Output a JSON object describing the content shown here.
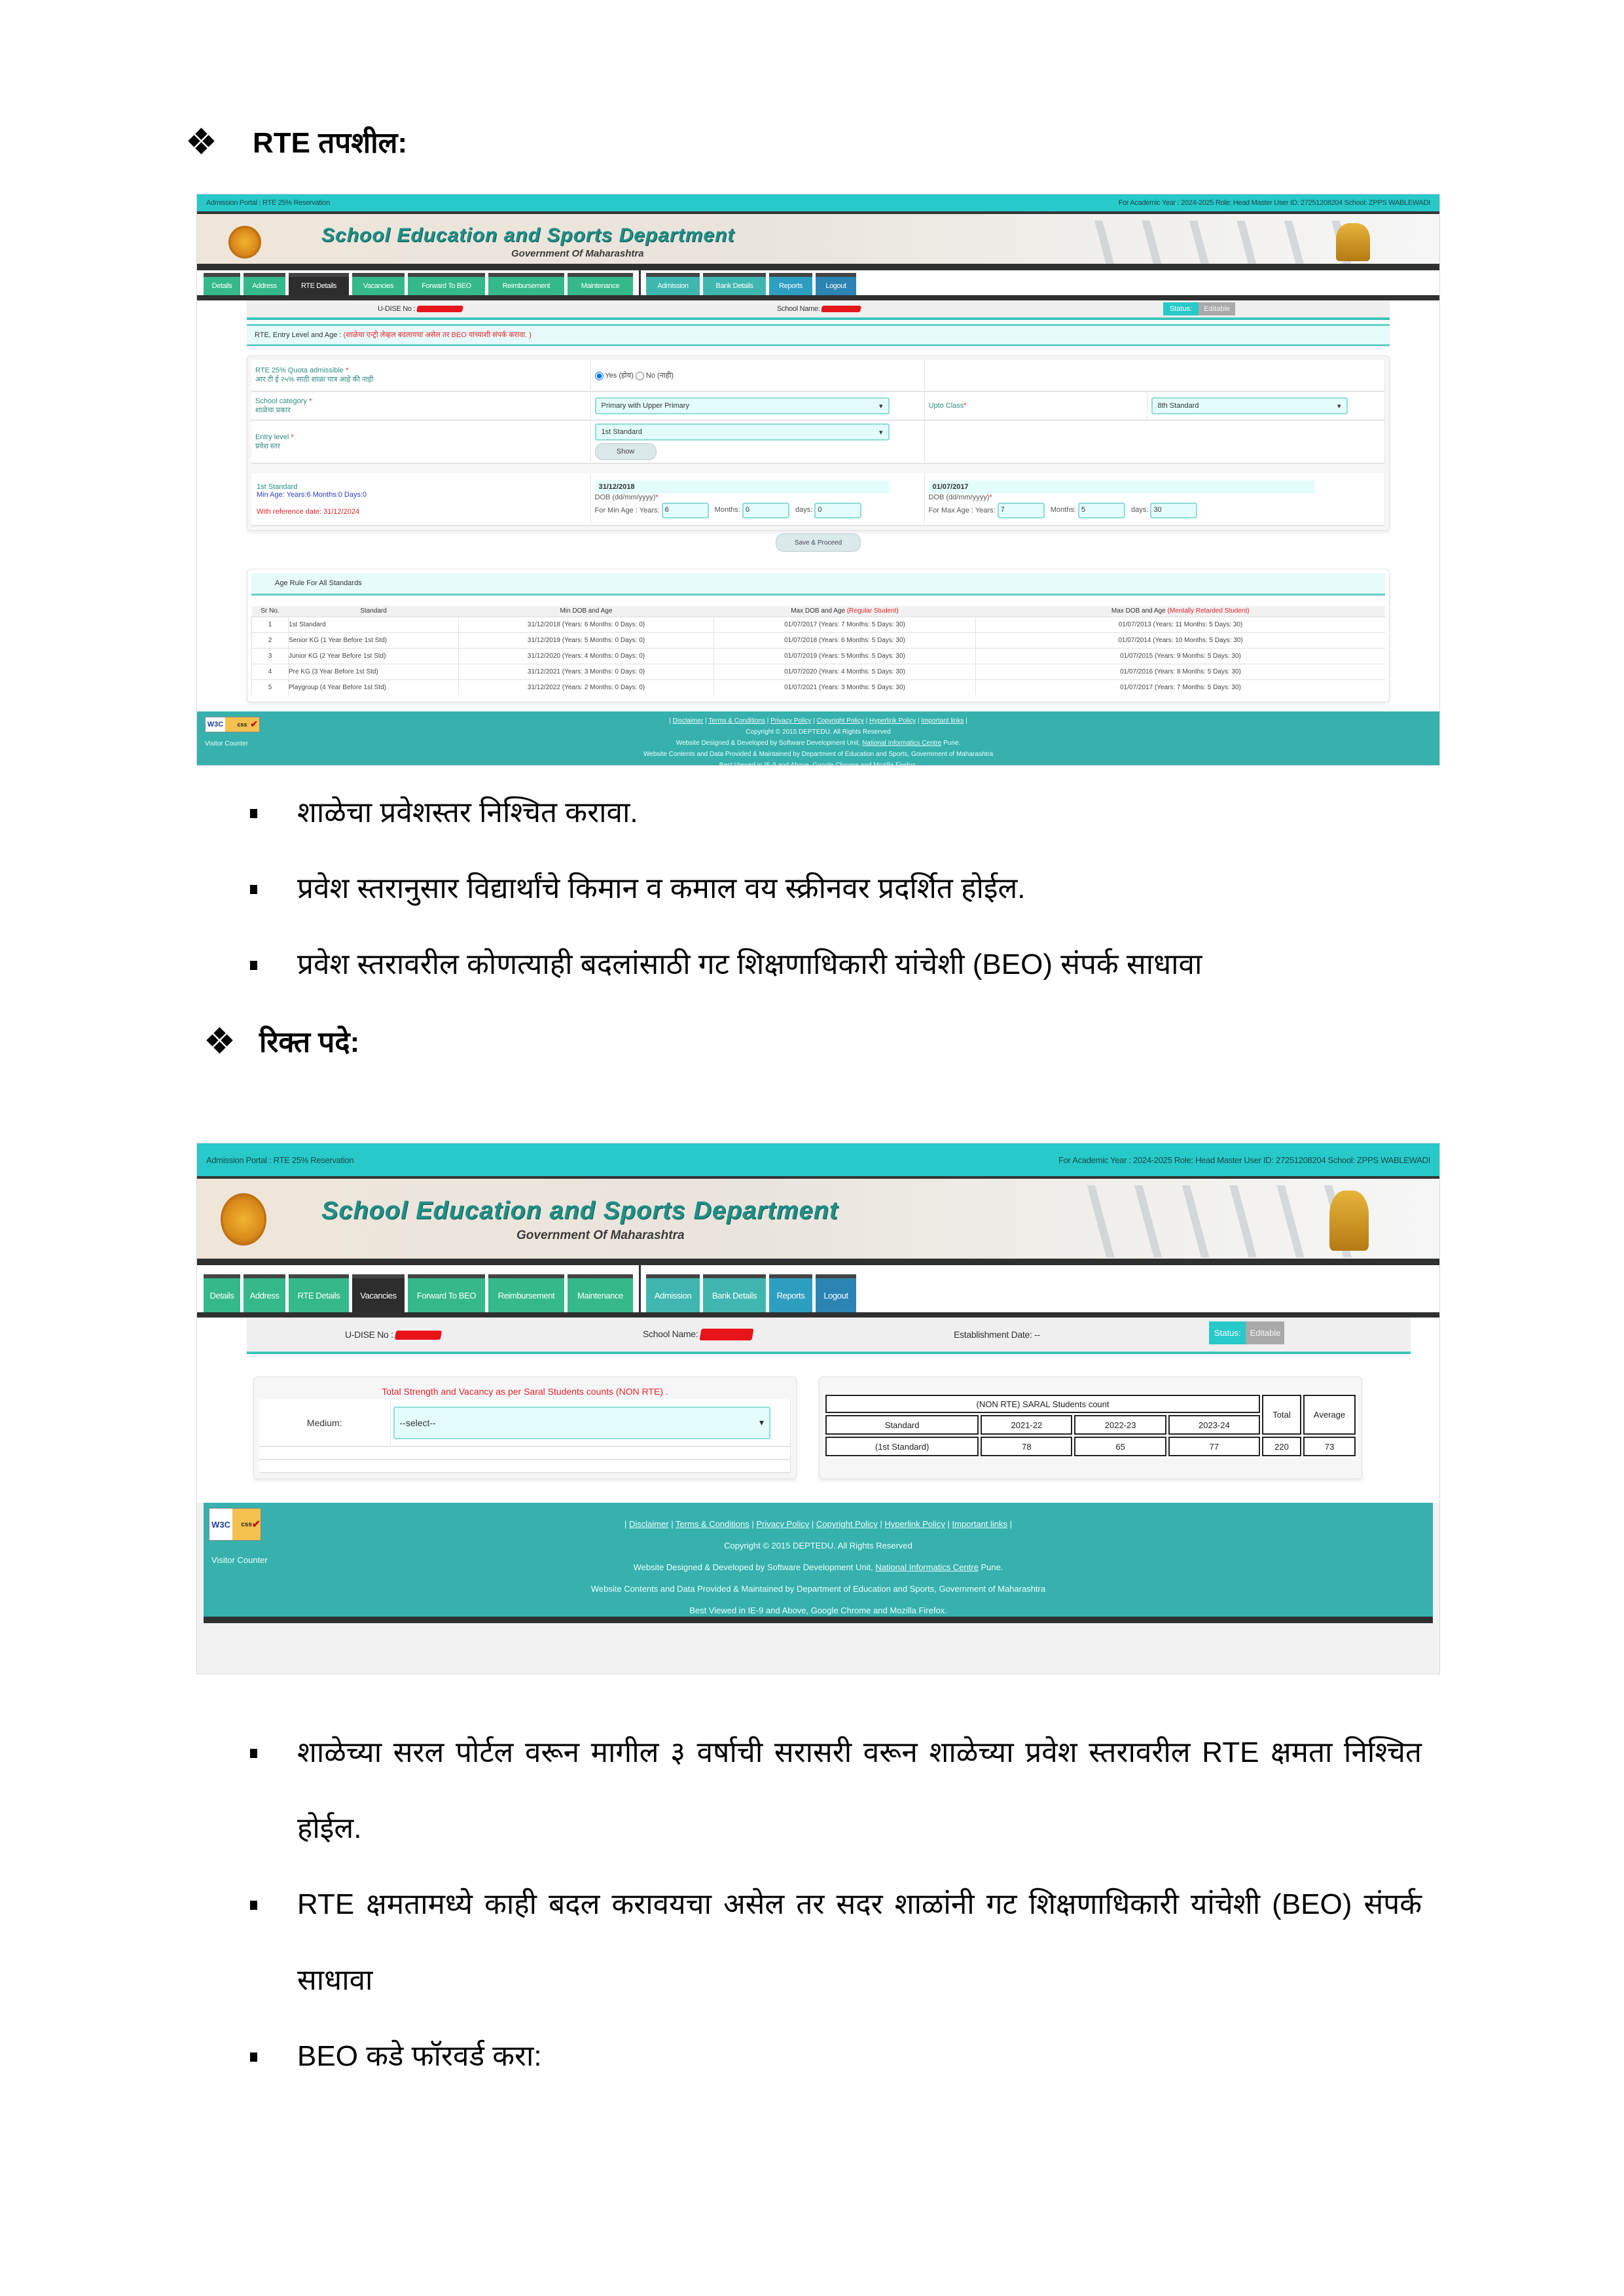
{
  "doc": {
    "section1_heading": "RTE तपशील:",
    "section1_bullets": [
      "शाळेचा प्रवेशस्तर निश्चित करावा.",
      "प्रवेश स्तरानुसार विद्यार्थांचे किमान व कमाल वय स्क्रीनवर प्रदर्शित होईल.",
      "प्रवेश स्तरावरील कोणत्याही बदलांसाठी गट शिक्षणाधिकारी यांचेशी (BEO) संपर्क साधावा"
    ],
    "section2_heading": "रिक्त पदे:",
    "section2_bullets": [
      "शाळेच्या सरल पोर्टल वरून मागील ३ वर्षाची सरासरी वरून शाळेच्या प्रवेश स्तरावरील RTE क्षमता निश्चित होईल.",
      "RTE क्षमतामध्ये काही बदल करावयचा असेल तर सदर शाळांनी गट शिक्षणाधिकारी यांचेशी (BEO) संपर्क साधावा",
      "BEO कडे फॉरवर्ड करा:"
    ]
  },
  "portal": {
    "top_left": "Admission Portal : RTE 25% Reservation",
    "top_right": "For Academic Year : 2024-2025   Role: Head Master   User ID: 27251208204   School: ZPPS WABLEWADI",
    "title": "School Education and Sports Department",
    "subtitle": "Government Of Maharashtra",
    "tabs": [
      "Details",
      "Address",
      "RTE Details",
      "Vacancies",
      "Forward To BEO",
      "Reimbursement",
      "Maintenance",
      "Admission",
      "Bank Details",
      "Reports",
      "Logout"
    ],
    "udise_label": "U-DISE No :",
    "school_name_label": "School Name:",
    "establishment_label": "Establishment Date: --",
    "status_label": "Status:",
    "status_value": "Editable",
    "footer": {
      "links": [
        "Disclaimer",
        "Terms & Conditions",
        "Privacy Policy",
        "Copyright Policy",
        "Hyperlink Policy",
        "Important links"
      ],
      "copyright": "Copyright © 2015 DEPTEDU. All Rights Reserved",
      "designed_prefix": "Website Designed & Developed by Software Development Unit, ",
      "designed_link": "National Informatics Centre",
      "designed_suffix": " Pune.",
      "contents": "Website Contents and Data Provided & Maintained by Department of Education and Sports, Government of Maharashtra",
      "best_viewed": "Best Viewed in IE-9 and Above, Google Chrome and Mozilla Firefox.",
      "visitor_counter": "Visitor Counter",
      "w3c_left": "W3C",
      "w3c_right": "css",
      "w3c_check": "✔"
    }
  },
  "rte_details": {
    "note_label": "RTE, Entry Level and Age :",
    "note_red": "(शाळेचा एन्ट्री लेव्हल बदलायचा असेल तर BEO यांच्याशी संपर्क करावा. )",
    "quota_label": "RTE 25% Quota admissible",
    "quota_label_mr": "आर टी ई २५% साठी शाळा पात्र आहे की नाही",
    "quota_yes": "Yes (होय)",
    "quota_no": "No (नाही)",
    "quota_selected": "yes",
    "category_label": "School category",
    "category_label_mr": "शाळेचा प्रकार",
    "category_value": "Primary with Upper Primary",
    "upto_label": "Upto Class",
    "upto_value": "8th Standard",
    "entry_label": "Entry level",
    "entry_label_mr": "प्रवेश स्तर",
    "entry_value": "1st Standard",
    "show_button": "Show",
    "age_std": "1st Standard",
    "age_min": "Min Age: Years:6 Months:0 Days:0",
    "age_ref": "With reference date: 31/12/2024",
    "min_date": "31/12/2018",
    "max_date": "01/07/2017",
    "dob_label": "DOB (dd/mm/yyyy)",
    "min_age_label": "For Min Age : Years:",
    "max_age_label": "For Max Age :  Years:",
    "months_label": "Months:",
    "days_label": "days:",
    "min_years": "6",
    "min_months": "0",
    "min_days": "0",
    "max_years": "7",
    "max_months": "5",
    "max_days": "30",
    "save_button": "Save & Proceed",
    "age_rule_title": "Age Rule For All Standards",
    "age_table": {
      "headers": [
        "Sr No.",
        "Standard",
        "Min DOB and Age",
        "Max DOB and Age",
        "Max DOB and Age"
      ],
      "header_suffix_regular": "(Regular Student)",
      "header_suffix_mr": "(Mentally Retarded Student)",
      "rows": [
        [
          "1",
          "1st Standard",
          "31/12/2018 (Years: 6 Months: 0 Days: 0)",
          "01/07/2017 (Years: 7 Months: 5 Days: 30)",
          "01/07/2013 (Years: 11 Months: 5 Days: 30)"
        ],
        [
          "2",
          "Senior KG (1 Year Before 1st Std)",
          "31/12/2019 (Years: 5 Months: 0 Days: 0)",
          "01/07/2018 (Years: 6 Months: 5 Days: 30)",
          "01/07/2014 (Years: 10 Months: 5 Days: 30)"
        ],
        [
          "3",
          "Junior KG (2 Year Before 1st Std)",
          "31/12/2020 (Years: 4 Months: 0 Days: 0)",
          "01/07/2019 (Years: 5 Months: 5 Days: 30)",
          "01/07/2015 (Years: 9 Months: 5 Days: 30)"
        ],
        [
          "4",
          "Pre KG (3 Year Before 1st Std)",
          "31/12/2021 (Years: 3 Months: 0 Days: 0)",
          "01/07/2020 (Years: 4 Months: 5 Days: 30)",
          "01/07/2016 (Years: 8 Months: 5 Days: 30)"
        ],
        [
          "5",
          "Playgroup (4 Year Before 1st Std)",
          "31/12/2022 (Years: 2 Months: 0 Days: 0)",
          "01/07/2021 (Years: 3 Months: 5 Days: 30)",
          "01/07/2017 (Years: 7 Months: 5 Days: 30)"
        ]
      ]
    }
  },
  "vacancies": {
    "strength_title": "Total Strength and Vacancy as per Saral Students counts (NON RTE) .",
    "medium_label": "Medium:",
    "medium_value": "--select--",
    "counts_title": "(NON RTE) SARAL Students count",
    "total_label": "Total",
    "average_label": "Average",
    "standard_label": "Standard",
    "years": [
      "2021-22",
      "2022-23",
      "2023-24"
    ],
    "row_standard": "(1st Standard)",
    "row_values": [
      "78",
      "65",
      "77"
    ],
    "row_total": "220",
    "row_average": "73"
  }
}
